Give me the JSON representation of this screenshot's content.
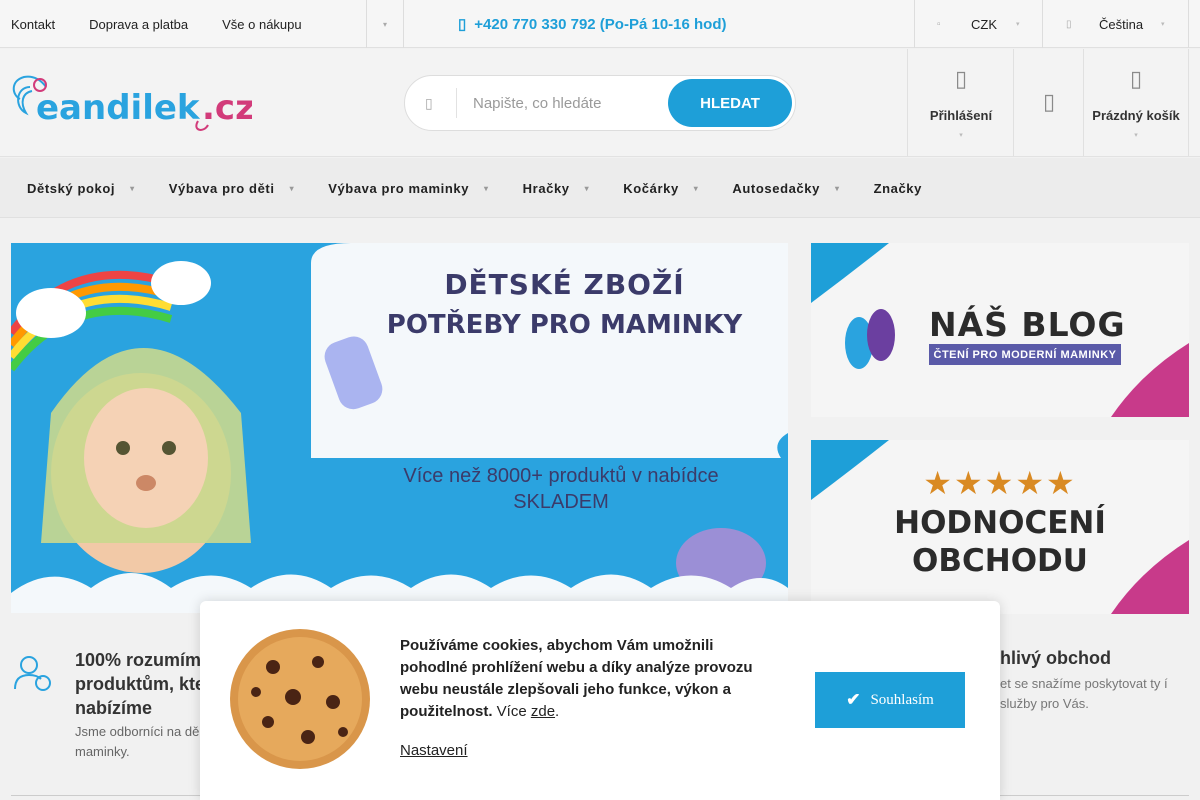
{
  "topbar": {
    "links": [
      "Kontakt",
      "Doprava a platba",
      "Vše o nákupu"
    ],
    "more_icon": "chevron-down-icon",
    "phone_icon": "phone-icon",
    "phone": "+420 770 330 792 (Po-Pá 10-16 hod)",
    "currency": "CZK",
    "language": "Čeština"
  },
  "header": {
    "logo_text": "eandilek.cz",
    "search": {
      "placeholder": "Napište, co hledáte",
      "button": "HLEDAT"
    },
    "login_label": "Přihlášení",
    "cart_label": "Prázdný košík"
  },
  "nav": {
    "items": [
      {
        "label": "Dětský pokoj",
        "submenu": true
      },
      {
        "label": "Výbava pro děti",
        "submenu": true
      },
      {
        "label": "Výbava pro maminky",
        "submenu": true
      },
      {
        "label": "Hračky",
        "submenu": true
      },
      {
        "label": "Kočárky",
        "submenu": true
      },
      {
        "label": "Autosedačky",
        "submenu": true
      },
      {
        "label": "Značky",
        "submenu": false
      }
    ]
  },
  "hero": {
    "line1": "DĚTSKÉ ZBOŽÍ",
    "line2": "POTŘEBY PRO MAMINKY",
    "line3": "Více než 8000+ produktů v nabídce SKLADEM"
  },
  "blog_banner": {
    "title": "NÁŠ BLOG",
    "subtitle": "ČTENÍ PRO MODERNÍ MAMINKY"
  },
  "review_banner": {
    "stars": "★★★★★",
    "line1": "HODNOCENÍ",
    "line2": "OBCHODU"
  },
  "features": {
    "f1_title": "100% rozumím produktům, kte nabízíme",
    "f1_text": "Jsme odborníci na dě potřeby pro maminky.",
    "f3_title": "ehlivý obchod",
    "f3_text": "et se snažíme poskytovat ty í služby pro Vás."
  },
  "cookie": {
    "text_bold": "Používáme cookies, abychom Vám umožnili pohodlné prohlížení webu a díky analýze provozu webu neustále zlepšovali jeho funkce, výkon a použitelnost.",
    "text_more": "Více",
    "link": "zde",
    "settings": "Nastavení",
    "accept": "Souhlasím"
  },
  "colors": {
    "accent": "#1e9fd8",
    "banner_blue": "#2aa3df",
    "text_dark": "#3b3b6a"
  }
}
